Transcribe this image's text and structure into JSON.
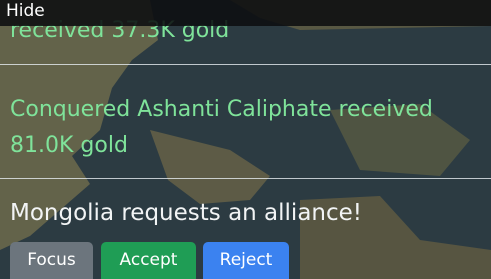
{
  "colors": {
    "ocean": "#3b4f57",
    "land": "#8e8a63",
    "message_text": "#7fe39a",
    "focus_button": "#6c757d",
    "accept_button": "#1f9d55",
    "reject_button": "#3b82f0"
  },
  "header": {
    "hide_label": "Hide"
  },
  "messages": [
    {
      "text": "received 37.3K gold"
    },
    {
      "text": "Conquered Ashanti Caliphate received 81.0K gold"
    }
  ],
  "alliance_request": {
    "text": "Mongolia requests an alliance!",
    "focus_label": "Focus",
    "accept_label": "Accept",
    "reject_label": "Reject"
  }
}
